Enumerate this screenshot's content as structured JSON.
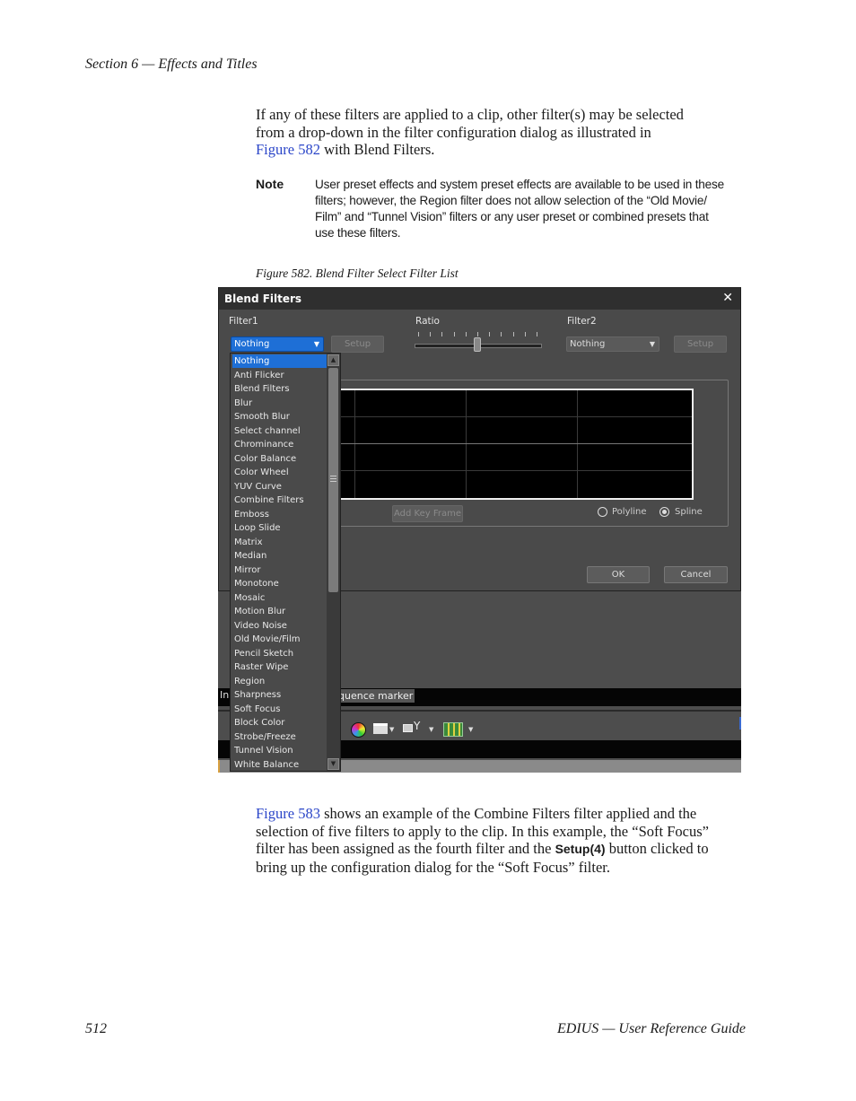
{
  "header": {
    "section": "Section 6 — Effects and Titles"
  },
  "intro": {
    "part1": "If any of these filters are applied to a clip, other filter(s) may be selected",
    "part2": "from a drop-down in the filter configuration dialog as illustrated in",
    "link": "Figure 582",
    "part3": " with Blend Filters."
  },
  "note": {
    "label": "Note",
    "lines": [
      "User preset effects and system preset effects are available to be used in these",
      "filters; however, the Region filter does not allow selection of the “Old Movie/",
      "Film” and “Tunnel Vision” filters or any user preset or combined presets that",
      "use these filters."
    ]
  },
  "caption": "Figure 582.  Blend Filter Select Filter List",
  "dialog": {
    "title": "Blend Filters",
    "close": "✕",
    "filter1_label": "Filter1",
    "ratio_label": "Ratio",
    "filter2_label": "Filter2",
    "filter1_value": "Nothing",
    "filter2_value": "Nothing",
    "setup": "Setup",
    "add_key_frame": "Add Key Frame",
    "polyline": "Polyline",
    "spline": "Spline",
    "ok": "OK",
    "cancel": "Cancel",
    "ratio_value_percent": 50
  },
  "background_ui": {
    "left_fragment": "In",
    "sequence_marker": "quence marker"
  },
  "filter_list": [
    "Nothing",
    "Anti Flicker",
    "Blend Filters",
    "Blur",
    "Smooth Blur",
    "Select channel",
    "Chrominance",
    "Color Balance",
    "Color Wheel",
    "YUV Curve",
    "Combine Filters",
    "Emboss",
    "Loop Slide",
    "Matrix",
    "Median",
    "Mirror",
    "Monotone",
    "Mosaic",
    "Motion Blur",
    "Video Noise",
    "Old Movie/Film",
    "Pencil Sketch",
    "Raster Wipe",
    "Region",
    "Sharpness",
    "Soft Focus",
    "Block Color",
    "Strobe/Freeze",
    "Tunnel Vision",
    "White Balance"
  ],
  "body2": {
    "link": "Figure 583",
    "p1": " shows an example of the Combine Filters filter applied and the",
    "p2": "selection of five filters to apply to the clip. In this example, the “Soft Focus”",
    "p3a": "filter has been assigned as the fourth filter and the ",
    "setup_bold": "Setup(4)",
    "p3b": " button clicked to",
    "p4": "bring up the configuration dialog for the “Soft Focus” filter."
  },
  "footer": {
    "page": "512",
    "guide": "EDIUS  —  User Reference Guide"
  }
}
